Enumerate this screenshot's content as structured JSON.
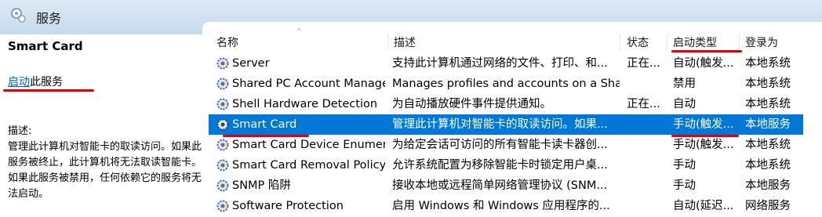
{
  "window": {
    "title": "服务"
  },
  "left_panel": {
    "service_title": "Smart Card",
    "start_link": "启动",
    "start_suffix": "此服务",
    "desc_label": "描述:",
    "description": "管理此计算机对智能卡的取读访问。如果此服务被终止，此计算机将无法取读智能卡。如果此服务被禁用，任何依赖它的服务将无法启动。"
  },
  "columns": {
    "name": "名称",
    "description": "描述",
    "status": "状态",
    "startup": "启动类型",
    "logon": "登录为"
  },
  "rows": [
    {
      "name": "Server",
      "description": "支持此计算机通过网络的文件、打印、和...",
      "status": "正在...",
      "startup": "自动(触发...",
      "logon": "本地系统"
    },
    {
      "name": "Shared PC Account Manager",
      "description": "Manages profiles and accounts on a Sha...",
      "status": "",
      "startup": "禁用",
      "logon": "本地系统"
    },
    {
      "name": "Shell Hardware Detection",
      "description": "为自动播放硬件事件提供通知。",
      "status": "正在...",
      "startup": "自动",
      "logon": "本地系统"
    },
    {
      "name": "Smart Card",
      "description": "管理此计算机对智能卡的取读访问。如果...",
      "status": "",
      "startup": "手动(触发...",
      "logon": "本地服务"
    },
    {
      "name": "Smart Card Device Enumer...",
      "description": "为给定会话可访问的所有智能卡读卡器创...",
      "status": "",
      "startup": "手动(触发...",
      "logon": "本地系统"
    },
    {
      "name": "Smart Card Removal Policy",
      "description": "允许系统配置为移除智能卡时锁定用户桌...",
      "status": "",
      "startup": "手动",
      "logon": "本地系统"
    },
    {
      "name": "SNMP 陷阱",
      "description": "接收本地或远程简单网络管理协议 (SNM...",
      "status": "",
      "startup": "手动",
      "logon": "本地服务"
    },
    {
      "name": "Software Protection",
      "description": "启用 Windows 和 Windows 应用程序的...",
      "status": "",
      "startup": "自动(延迟...",
      "logon": "网络服务"
    }
  ],
  "selected_row": "Smart Card",
  "colors": {
    "selection": "#0078d7",
    "link": "#0066cc",
    "annotation": "#e3000b"
  }
}
